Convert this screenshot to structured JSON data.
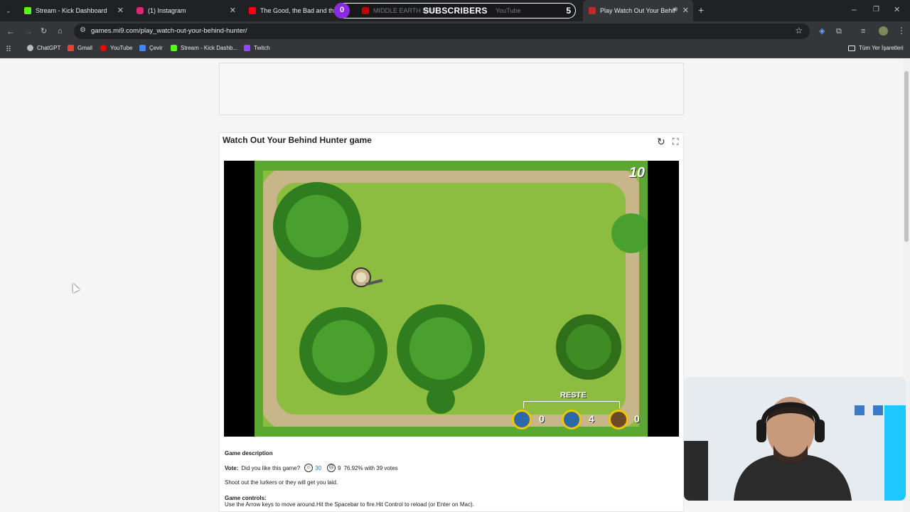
{
  "tabs": [
    {
      "title": "Stream - Kick Dashboard",
      "color": "#53fc18"
    },
    {
      "title": "(1) Instagram",
      "color": "#d62976"
    },
    {
      "title": "The Good, the Bad and the U",
      "color": "#ff0000"
    },
    {
      "title": "MIDDLE EARTH MUS",
      "suffix": "YouTube",
      "color": "#ff0000"
    },
    {
      "title": "Play Watch Out Your Behind",
      "color": "#c62828"
    }
  ],
  "subscribers": {
    "count": "0",
    "label": "SUBSCRIBERS",
    "goal": "5"
  },
  "address": {
    "url": "games.mi9.com/play_watch-out-your-behind-hunter/"
  },
  "bookmarks": [
    {
      "label": "ChatGPT",
      "color": "#bbbbbb"
    },
    {
      "label": "Gmail",
      "color": "#ea4335"
    },
    {
      "label": "YouTube",
      "color": "#ff0000"
    },
    {
      "label": "Çevir",
      "color": "#4285f4"
    },
    {
      "label": "Stream - Kick Dashb...",
      "color": "#53fc18"
    },
    {
      "label": "Twitch",
      "color": "#9146ff"
    }
  ],
  "bookmarks_folder": "Tüm Yer İşaretleri",
  "game": {
    "title": "Watch Out Your Behind Hunter game",
    "score": "10",
    "hud_label": "RESTE",
    "hud_counts": [
      "0",
      "4",
      "0"
    ]
  },
  "description": {
    "heading": "Game description",
    "vote_label": "Vote:",
    "vote_question": "Did you like this game?",
    "likes": "30",
    "dislikes": "9",
    "rating": "76.92% with 39 votes",
    "summary": "Shoot out the lurkers or they will get you laid.",
    "controls_heading": "Game controls:",
    "controls": "Use the Arrow keys to move around.Hit the Spacebar to fire.Hit Control to reload (or Enter on Mac)."
  }
}
